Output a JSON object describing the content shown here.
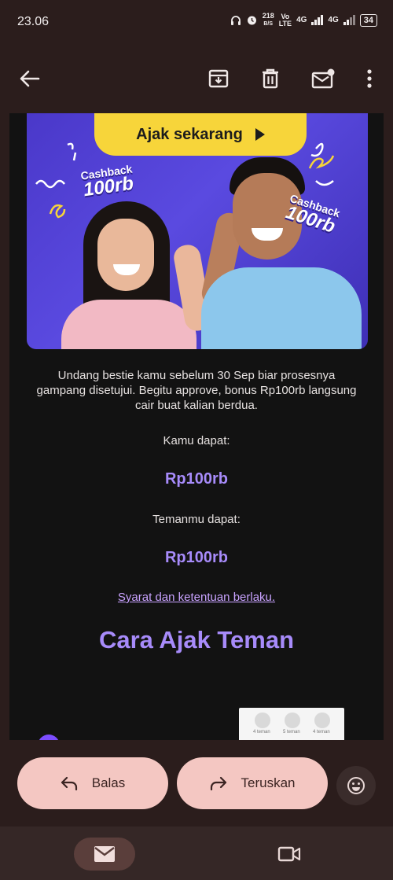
{
  "status_bar": {
    "time": "23.06",
    "net_speed_value": "218",
    "net_speed_unit": "B/S",
    "volte_top": "Vo",
    "volte_bottom": "LTE",
    "network1": "4G",
    "network2": "4G",
    "battery": "34"
  },
  "toolbar": {
    "back_icon": "arrow-left-icon",
    "archive_icon": "archive-icon",
    "delete_icon": "trash-icon",
    "mark_unread_icon": "mail-unread-icon",
    "more_icon": "more-vertical-icon"
  },
  "email": {
    "banner": {
      "cta_label": "Ajak sekarang",
      "cashback_left_top": "Cashback",
      "cashback_left_bottom": "100rb",
      "cashback_right_top": "Cashback",
      "cashback_right_bottom": "100rb",
      "accent": "#f7d53a",
      "background": "#4a38c9"
    },
    "paragraph": "Undang bestie kamu sebelum 30 Sep biar prosesnya gampang disetujui. Begitu approve, bonus Rp100rb langsung cair buat kalian berdua.",
    "you_get_label": "Kamu dapat:",
    "you_get_amount": "Rp100rb",
    "friend_get_label": "Temanmu dapat:",
    "friend_get_amount": "Rp100rb",
    "terms_link": "Syarat dan ketentuan berlaku.",
    "section_heading": "Cara Ajak Teman",
    "steps_preview": [
      "4 teman",
      "5 teman",
      "4 teman"
    ],
    "amount_color": "#a78bfa"
  },
  "actions": {
    "reply_label": "Balas",
    "forward_label": "Teruskan",
    "reply_icon": "reply-icon",
    "forward_icon": "forward-icon",
    "emoji_icon": "emoji-smile-icon"
  },
  "bottom_nav": {
    "mail_icon": "mail-icon",
    "meet_icon": "video-camera-icon"
  }
}
